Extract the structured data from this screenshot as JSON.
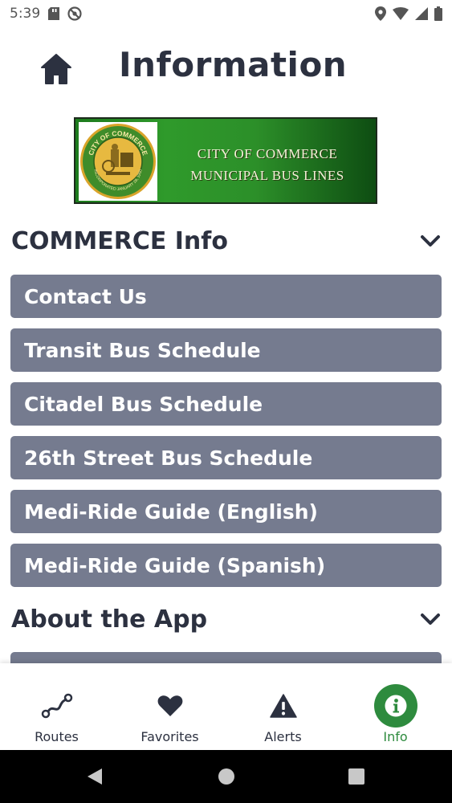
{
  "status_bar": {
    "time": "5:39",
    "left_icons": [
      "sd-card-icon",
      "no-disturb-icon"
    ],
    "right_icons": [
      "location-icon",
      "wifi-icon",
      "signal-icon",
      "battery-icon"
    ]
  },
  "header": {
    "title": "Information",
    "home_icon": "home-icon"
  },
  "banner": {
    "line1": "CITY OF COMMERCE",
    "line2": "MUNICIPAL BUS LINES",
    "seal_top_text": "CITY OF COMMERCE",
    "seal_bottom_text": "INCORPORATED JANUARY 28, 1960"
  },
  "sections": [
    {
      "title": "COMMERCE Info",
      "items": [
        "Contact Us",
        "Transit Bus Schedule",
        "Citadel Bus Schedule",
        "26th Street Bus Schedule",
        "Medi-Ride Guide (English)",
        "Medi-Ride Guide (Spanish)"
      ]
    },
    {
      "title": "About the App",
      "items": []
    }
  ],
  "tabs": [
    {
      "label": "Routes",
      "icon": "route-icon",
      "active": false
    },
    {
      "label": "Favorites",
      "icon": "heart-icon",
      "active": false
    },
    {
      "label": "Alerts",
      "icon": "alert-icon",
      "active": false
    },
    {
      "label": "Info",
      "icon": "info-icon",
      "active": true
    }
  ],
  "colors": {
    "accent": "#2e8b3e",
    "item_background": "#757b8f",
    "text_dark": "#2c3140",
    "banner_green": "#2c8f29"
  }
}
